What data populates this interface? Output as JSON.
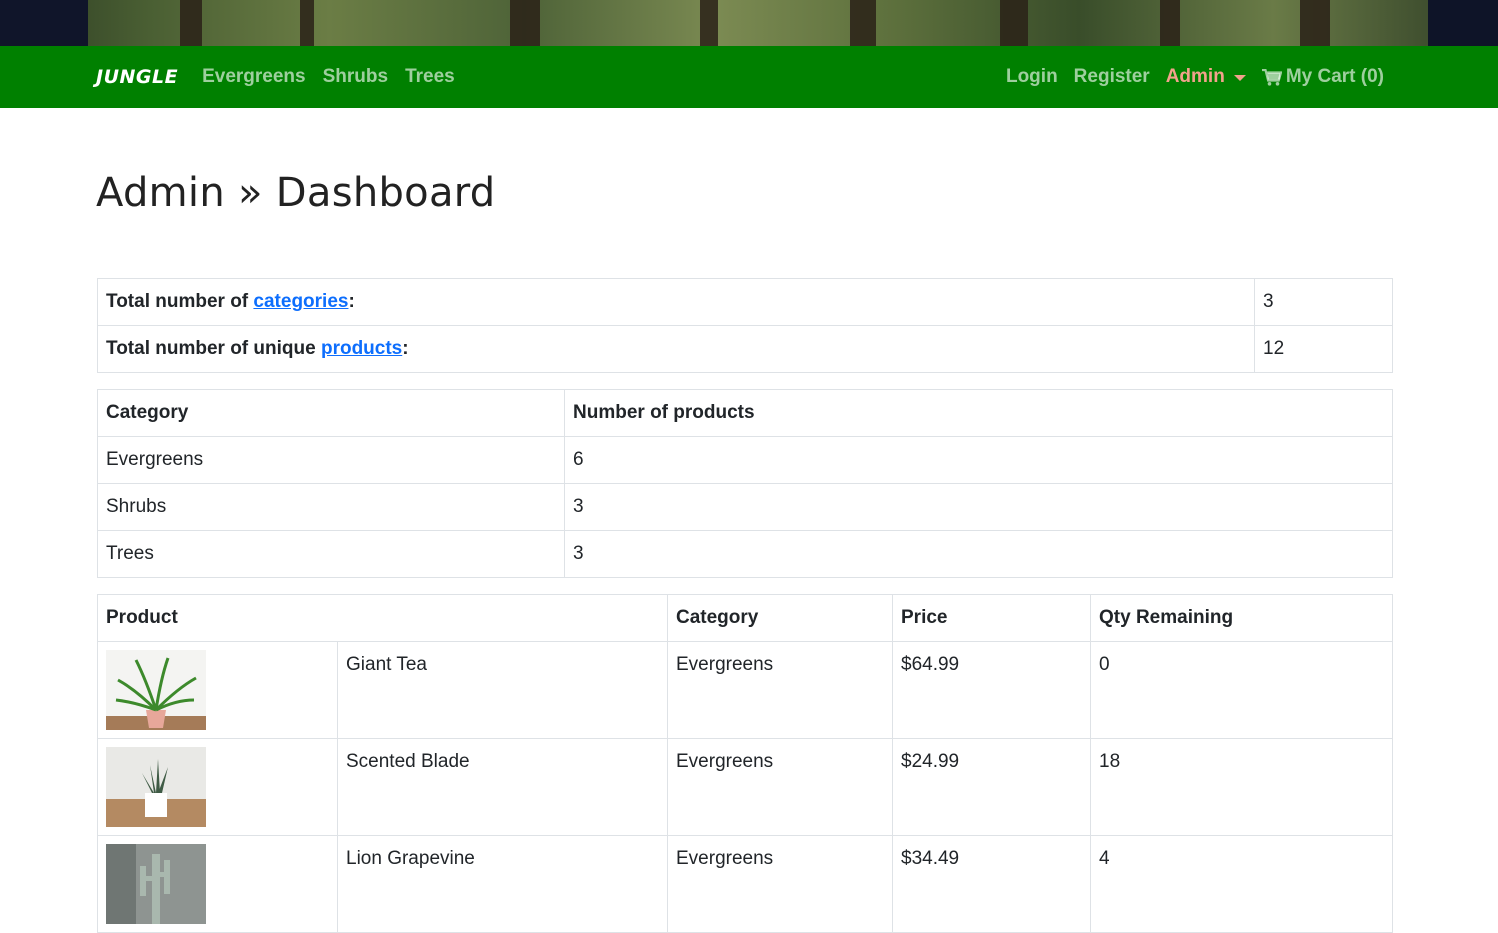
{
  "nav": {
    "brand": "JUNGLE",
    "left_links": [
      "Evergreens",
      "Shrubs",
      "Trees"
    ],
    "login": "Login",
    "register": "Register",
    "admin": "Admin",
    "cart": "My Cart (0)",
    "icons": {
      "cart": "shopping-cart-icon",
      "admin_caret": "caret-down-icon"
    },
    "colors": {
      "navbar": "#008000",
      "admin": "#f2a28c",
      "link": "#0d6efd"
    }
  },
  "page": {
    "title": "Admin » Dashboard"
  },
  "summary": {
    "categories_prefix": "Total number of ",
    "categories_link": "categories",
    "categories_suffix": ":",
    "categories_count": "3",
    "products_prefix": "Total number of unique ",
    "products_link": "products",
    "products_suffix": ":",
    "products_count": "12"
  },
  "category_table": {
    "headers": [
      "Category",
      "Number of products"
    ],
    "rows": [
      [
        "Evergreens",
        "6"
      ],
      [
        "Shrubs",
        "3"
      ],
      [
        "Trees",
        "3"
      ]
    ]
  },
  "product_table": {
    "headers": [
      "Product",
      "Category",
      "Price",
      "Qty Remaining"
    ],
    "rows": [
      {
        "name": "Giant Tea",
        "category": "Evergreens",
        "price": "$64.99",
        "qty": "0"
      },
      {
        "name": "Scented Blade",
        "category": "Evergreens",
        "price": "$24.99",
        "qty": "18"
      },
      {
        "name": "Lion Grapevine",
        "category": "Evergreens",
        "price": "$34.49",
        "qty": "4"
      }
    ]
  }
}
